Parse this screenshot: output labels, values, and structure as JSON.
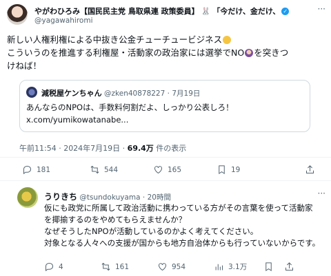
{
  "author": {
    "name": "やがわひろみ",
    "title_tag": "【国民民主党 鳥取県連 政策委員】",
    "badge_symbol": "🐰",
    "tagline": "「今だけ、金だけ、",
    "verified_glyph": "✓",
    "handle": "@yagawahiromi"
  },
  "tweet": {
    "line1": "新しい人権利権による中抜き公金チューチュービジネス",
    "line2a": "こういうのを推進する利権屋・活動家の政治家には選挙でNO",
    "line2b": "を突きつ",
    "line3": "けねば！"
  },
  "quote": {
    "name": "減税屋ケンちゃん",
    "handle": "@zken40878227",
    "sep": "·",
    "date": "7月19日",
    "text": "あんならのNPOは、手数料何割だよ、しっかり公表しろ！",
    "link": "x.com/yumikowatanabe..."
  },
  "meta": {
    "time": "午前11:54 · 2024年7月19日 · ",
    "views": "69.4万",
    "views_label": " 件の表示"
  },
  "actions": {
    "replies": "181",
    "reposts": "544",
    "likes": "165",
    "bookmarks": "19"
  },
  "reply": {
    "name": "うりきち",
    "handle": "@tsundokuyama",
    "sep": "·",
    "time": "20時間",
    "line1": "仮にも政党に所属して政治活動に携わっている方がその言葉を使って活動家",
    "line2": "を揶揄するのをやめてもらえませんか？",
    "line3": "なぜそうしたNPOが活動しているのかよく考えてください。",
    "line4": "対象となる人々への支援が国からも地方自治体からも行っていないからです。",
    "replies": "4",
    "reposts": "161",
    "likes": "954",
    "views": "3.1万"
  },
  "more_glyph": "···"
}
